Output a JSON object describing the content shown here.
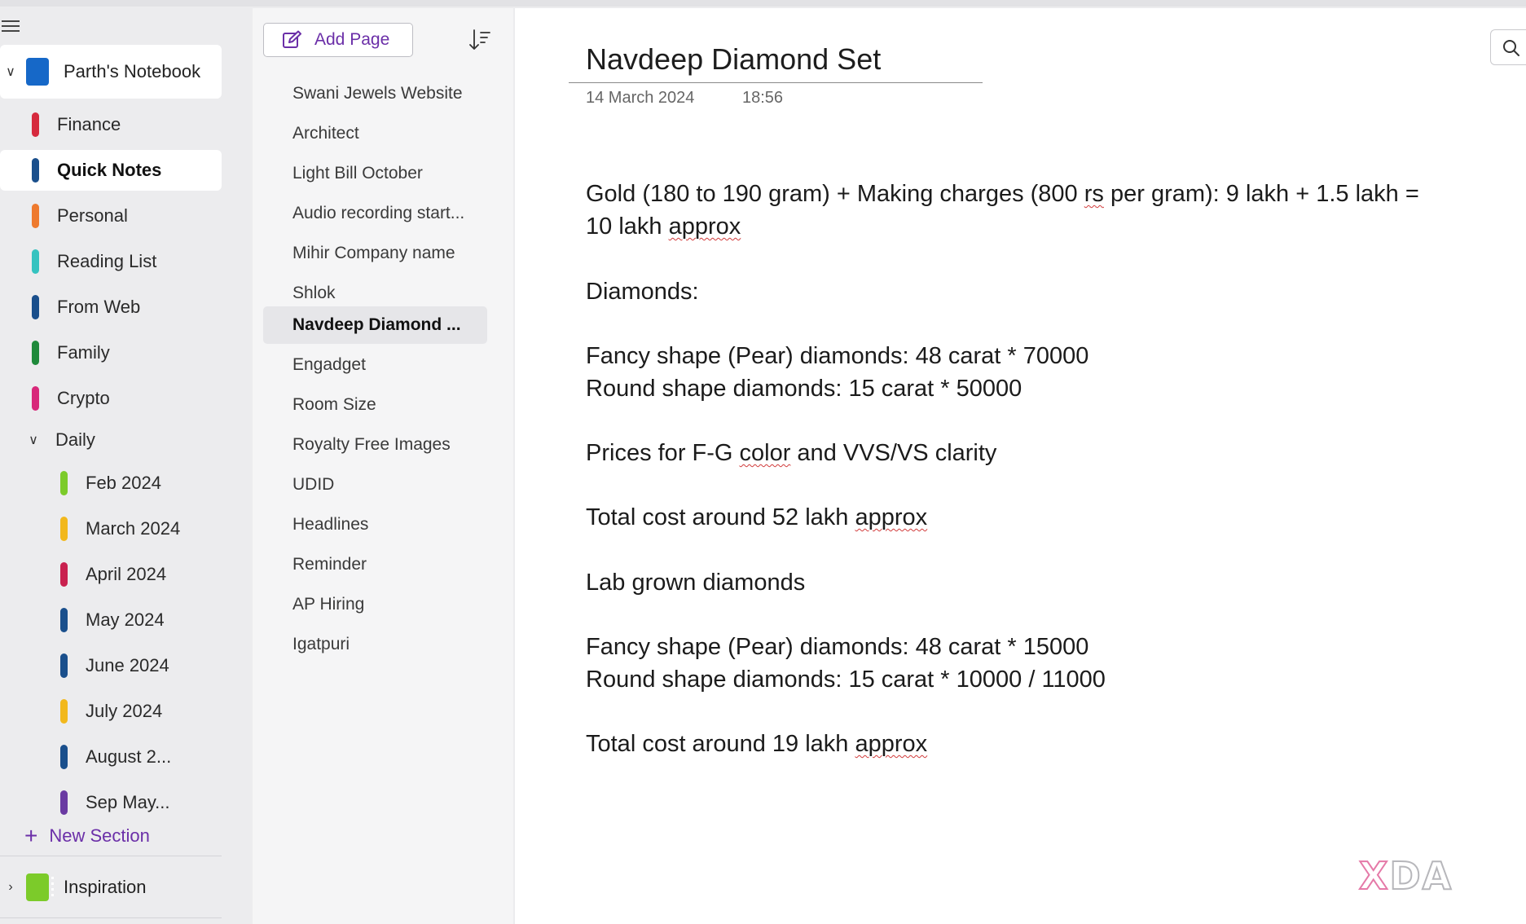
{
  "colors": {
    "accent": "#6b2fa8",
    "notebook_blue": "#1668c8",
    "notebook_green": "#7ccb2a",
    "section_colors": {
      "finance": "#d62a3e",
      "quick_notes": "#1a4f8c",
      "personal": "#ee7a2e",
      "reading_list": "#35c3c0",
      "from_web": "#1a4f8c",
      "family": "#1f8a3b",
      "crypto": "#d8287a",
      "feb": "#7ccb2a",
      "march": "#f2b81c",
      "april": "#c9214f",
      "may": "#1a4f8c",
      "june": "#1a4f8c",
      "july": "#f2b81c",
      "august": "#1a4f8c",
      "sep": "#6a3aa2"
    }
  },
  "sidebar": {
    "menu_icon": "hamburger-icon",
    "notebook": {
      "name": "Parth's Notebook",
      "icon": "notebook-icon"
    },
    "sections": [
      {
        "label": "Finance"
      },
      {
        "label": "Quick Notes"
      },
      {
        "label": "Personal"
      },
      {
        "label": "Reading List"
      },
      {
        "label": "From Web"
      },
      {
        "label": "Family"
      },
      {
        "label": "Crypto"
      }
    ],
    "group": {
      "label": "Daily",
      "children": [
        {
          "label": "Feb 2024"
        },
        {
          "label": "March 2024"
        },
        {
          "label": "April 2024"
        },
        {
          "label": "May 2024"
        },
        {
          "label": "June 2024"
        },
        {
          "label": "July 2024"
        },
        {
          "label": "August 2..."
        },
        {
          "label": "Sep May..."
        }
      ]
    },
    "new_section": "New Section",
    "other_notebook": {
      "name": "Inspiration"
    }
  },
  "pages": {
    "add_page": "Add Page",
    "items": [
      {
        "label": "Swani Jewels Website"
      },
      {
        "label": "Architect"
      },
      {
        "label": "Light Bill October"
      },
      {
        "label": "Audio recording start..."
      },
      {
        "label": "Mihir Company name"
      },
      {
        "label": "Shlok"
      },
      {
        "label": "Navdeep Diamond ..."
      },
      {
        "label": "Engadget"
      },
      {
        "label": "Room Size"
      },
      {
        "label": "Royalty Free Images"
      },
      {
        "label": "UDID"
      },
      {
        "label": "Headlines"
      },
      {
        "label": "Reminder"
      },
      {
        "label": "AP Hiring"
      },
      {
        "label": "Igatpuri"
      }
    ]
  },
  "note": {
    "title": "Navdeep Diamond Set",
    "date": "14 March 2024",
    "time": "18:56",
    "lines": {
      "l1a": "Gold (180 to 190 gram) + Making charges (800 ",
      "l1b": "rs",
      "l1c": " per gram): 9 lakh + 1.5 lakh =",
      "l2a": "10 lakh ",
      "l2b": "approx",
      "l3": "Diamonds:",
      "l4": "Fancy shape (Pear) diamonds: 48 carat * 70000",
      "l5": "Round shape diamonds: 15 carat * 50000",
      "l6a": "Prices for F-G ",
      "l6b": "color",
      "l6c": " and VVS/VS clarity",
      "l7a": "Total cost around 52 lakh ",
      "l7b": "approx",
      "l8": "Lab grown diamonds",
      "l9": "Fancy shape (Pear) diamonds: 48 carat * 15000",
      "l10": "Round shape diamonds: 15 carat * 10000 / 11000",
      "l11a": "Total cost around 19 lakh ",
      "l11b": "approx"
    }
  },
  "watermark": {
    "a": "X",
    "b": "DA"
  }
}
